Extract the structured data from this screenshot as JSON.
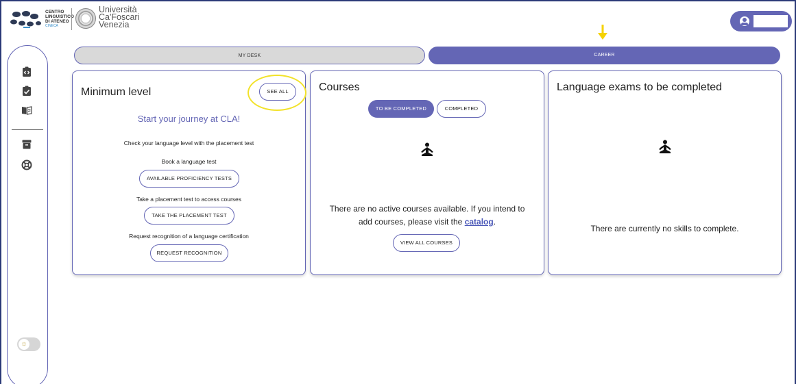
{
  "header": {
    "cla_logo_lines": [
      "CENTRO",
      "LINGUISTICO",
      "DI ATENEO"
    ],
    "cla_logo_sub": "CINECA",
    "university_lines": [
      "Università",
      "Ca'Foscari",
      "Venezia"
    ]
  },
  "tabs": [
    {
      "label": "MY DESK",
      "active": false
    },
    {
      "label": "CAREER",
      "active": true
    }
  ],
  "minimum_level": {
    "title": "Minimum level",
    "see_all": "SEE ALL",
    "journey": "Start your journey at CLA!",
    "check_text": "Check your language level with the placement test",
    "book_text": "Book a language test",
    "proficiency_button": "AVAILABLE PROFICIENCY TESTS",
    "placement_text": "Take a placement test to access courses",
    "placement_button": "TAKE THE PLACEMENT TEST",
    "recognition_text": "Request recognition of a language certification",
    "recognition_button": "REQUEST RECOGNITION"
  },
  "courses": {
    "title": "Courses",
    "tab_to_be_completed": "TO BE COMPLETED",
    "tab_completed": "COMPLETED",
    "empty_line1": "There are no active courses available. If you intend to",
    "empty_line2_prefix": "add courses, please visit the ",
    "catalog_link": "catalog",
    "empty_line2_suffix": ".",
    "view_all_button": "VIEW ALL COURSES"
  },
  "exams": {
    "title": "Language exams to be completed",
    "empty": "There are currently no skills to complete."
  },
  "colors": {
    "accent": "#6466b5",
    "highlight": "#f2e22a",
    "arrow": "#f5d200"
  }
}
